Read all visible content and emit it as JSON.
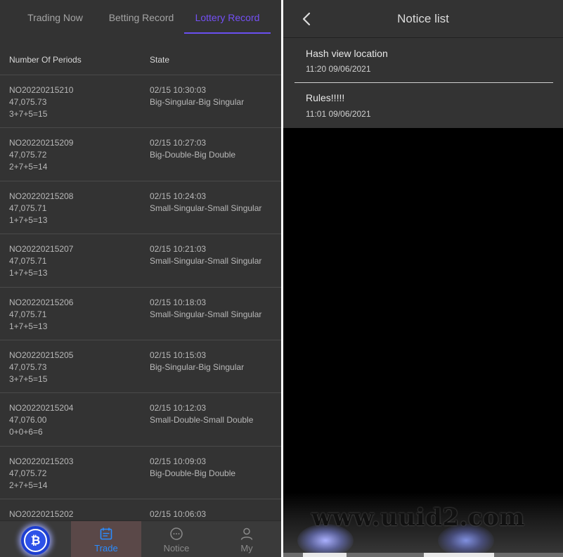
{
  "left_panel": {
    "tabs": [
      {
        "label": "Trading Now",
        "active": false
      },
      {
        "label": "Betting Record",
        "active": false
      },
      {
        "label": "Lottery Record",
        "active": true
      }
    ],
    "columns": [
      "Number Of Periods",
      "State"
    ],
    "records": [
      {
        "period": "NO20220215210",
        "value": "47,075.73",
        "sum": "3+7+5=15",
        "time": "02/15 10:30:03",
        "state": "Big-Singular-Big Singular"
      },
      {
        "period": "NO20220215209",
        "value": "47,075.72",
        "sum": "2+7+5=14",
        "time": "02/15 10:27:03",
        "state": "Big-Double-Big Double"
      },
      {
        "period": "NO20220215208",
        "value": "47,075.71",
        "sum": "1+7+5=13",
        "time": "02/15 10:24:03",
        "state": "Small-Singular-Small Singular"
      },
      {
        "period": "NO20220215207",
        "value": "47,075.71",
        "sum": "1+7+5=13",
        "time": "02/15 10:21:03",
        "state": "Small-Singular-Small Singular"
      },
      {
        "period": "NO20220215206",
        "value": "47,075.71",
        "sum": "1+7+5=13",
        "time": "02/15 10:18:03",
        "state": "Small-Singular-Small Singular"
      },
      {
        "period": "NO20220215205",
        "value": "47,075.73",
        "sum": "3+7+5=15",
        "time": "02/15 10:15:03",
        "state": "Big-Singular-Big Singular"
      },
      {
        "period": "NO20220215204",
        "value": "47,076.00",
        "sum": "0+0+6=6",
        "time": "02/15 10:12:03",
        "state": "Small-Double-Small Double"
      },
      {
        "period": "NO20220215203",
        "value": "47,075.72",
        "sum": "2+7+5=14",
        "time": "02/15 10:09:03",
        "state": "Big-Double-Big Double"
      },
      {
        "period": "NO20220215202",
        "value": "",
        "sum": "",
        "time": "02/15 10:06:03",
        "state": ""
      }
    ],
    "bottom_nav": {
      "trade": "Trade",
      "notice": "Notice",
      "my": "My",
      "active": "Trade",
      "accent": "#2a8cff"
    }
  },
  "right_panel": {
    "title": "Notice list",
    "notices": [
      {
        "title": "Hash view location",
        "time": "11:20 09/06/2021"
      },
      {
        "title": "Rules!!!!!",
        "time": "11:01 09/06/2021"
      }
    ],
    "watermark": "www.uuid2.com"
  },
  "colors": {
    "panel_bg": "#333333",
    "active_tab": "#7450f5",
    "right_bg": "#000000"
  }
}
